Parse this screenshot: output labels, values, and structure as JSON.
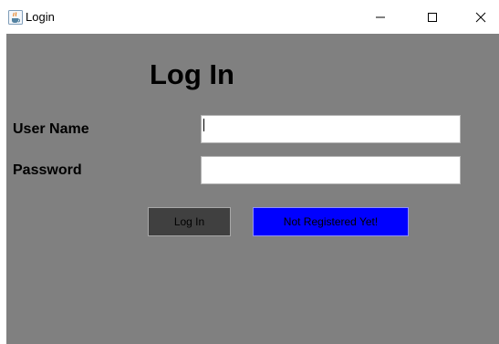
{
  "window": {
    "title": "Login",
    "icon": "java-coffee-cup-icon",
    "controls": [
      "minimize-icon",
      "maximize-icon",
      "close-icon"
    ]
  },
  "form": {
    "heading": "Log In",
    "username_label": "User Name",
    "username_value": "",
    "password_label": "Password",
    "password_value": "",
    "login_button": "Log In",
    "register_button": "Not Registered Yet!"
  },
  "colors": {
    "panel_background": "#808080",
    "login_button_background": "#404040",
    "register_button_background": "#0000ff"
  }
}
